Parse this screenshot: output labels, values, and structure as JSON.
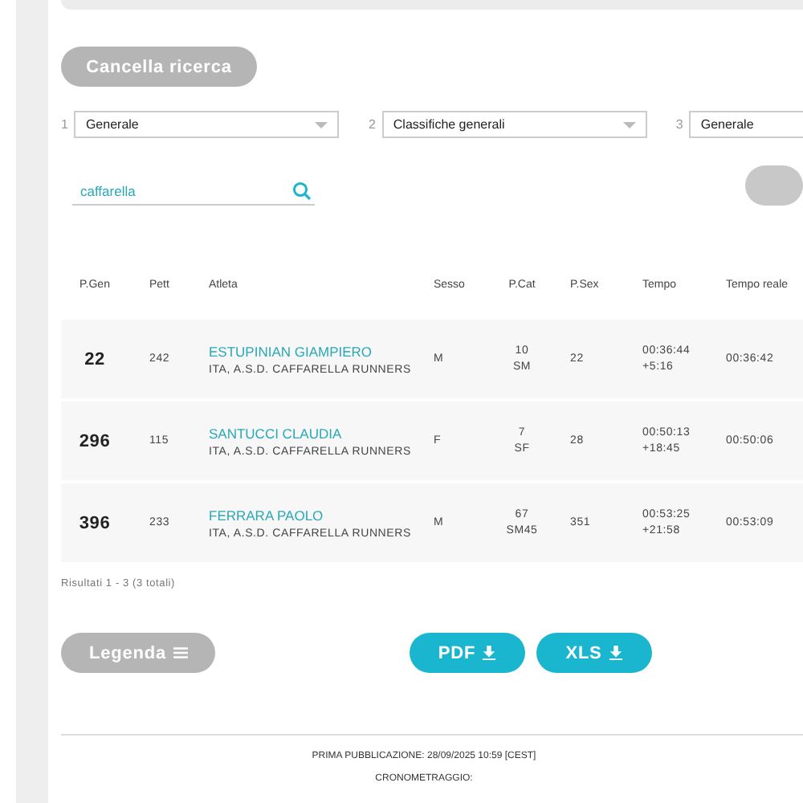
{
  "reset_button": {
    "label": "Cancella ricerca"
  },
  "filters": [
    {
      "step": "1",
      "value": "Generale"
    },
    {
      "step": "2",
      "value": "Classifiche generali"
    },
    {
      "step": "3",
      "value": "Generale"
    }
  ],
  "search": {
    "value": "caffarella"
  },
  "table": {
    "columns": [
      "P.Gen",
      "Pett",
      "Atleta",
      "Sesso",
      "P.Cat",
      "P.Sex",
      "Tempo",
      "Tempo reale"
    ],
    "rows": [
      {
        "p_gen": "22",
        "pett": "242",
        "name": "ESTUPINIAN GIAMPIERO",
        "team": "ITA, A.S.D. CAFFARELLA RUNNERS",
        "sesso": "M",
        "p_cat": "10",
        "category": "SM",
        "p_sex": "22",
        "tempo": "00:36:44",
        "gap": "+5:16",
        "tempo_reale": "00:36:42"
      },
      {
        "p_gen": "296",
        "pett": "115",
        "name": "SANTUCCI CLAUDIA",
        "team": "ITA, A.S.D. CAFFARELLA RUNNERS",
        "sesso": "F",
        "p_cat": "7",
        "category": "SF",
        "p_sex": "28",
        "tempo": "00:50:13",
        "gap": "+18:45",
        "tempo_reale": "00:50:06"
      },
      {
        "p_gen": "396",
        "pett": "233",
        "name": "FERRARA PAOLO",
        "team": "ITA, A.S.D. CAFFARELLA RUNNERS",
        "sesso": "M",
        "p_cat": "67",
        "category": "SM45",
        "p_sex": "351",
        "tempo": "00:53:25",
        "gap": "+21:58",
        "tempo_reale": "00:53:09"
      }
    ]
  },
  "results_summary": "Risultati 1 - 3 (3 totali)",
  "legend_button": {
    "label": "Legenda"
  },
  "export_buttons": [
    {
      "label": "PDF"
    },
    {
      "label": "XLS"
    }
  ],
  "footer": [
    "PRIMA PUBBLICAZIONE: 28/09/2025 10:59 [CEST]",
    "CRONOMETRAGGIO:"
  ]
}
